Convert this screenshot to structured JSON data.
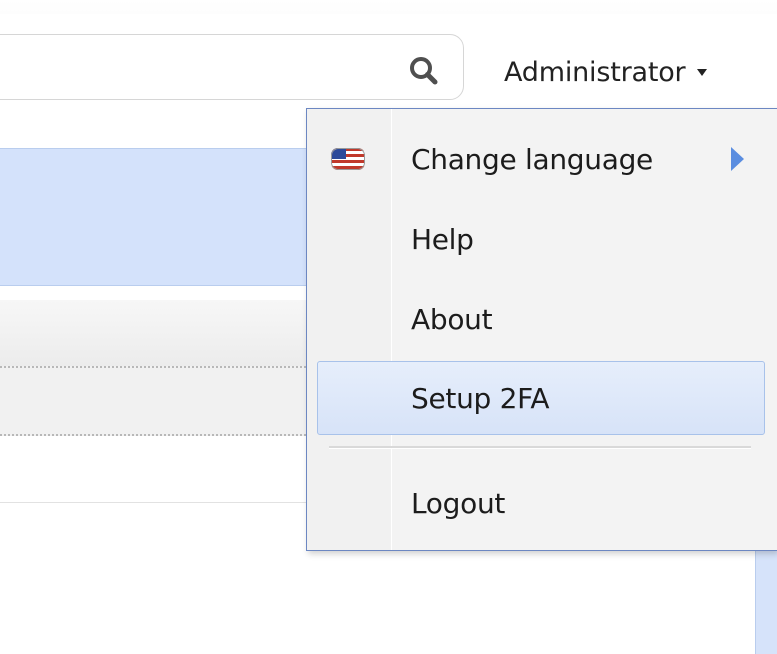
{
  "header": {
    "search": {
      "value": "",
      "icon": "search-icon"
    },
    "user_menu": {
      "label": "Administrator",
      "caret_icon": "caret-down-icon"
    }
  },
  "dropdown": {
    "items": [
      {
        "label": "Change language",
        "icon": "us-flag-icon",
        "has_submenu": true
      },
      {
        "label": "Help"
      },
      {
        "label": "About"
      },
      {
        "label": "Setup 2FA",
        "state": "hovered"
      },
      {
        "label": "Logout"
      }
    ]
  },
  "colors": {
    "accent_blue": "#5a8de0",
    "hover_bg": "#d7e3f8",
    "menu_border": "#6c87c2",
    "selected_band": "#d4e2fb"
  }
}
